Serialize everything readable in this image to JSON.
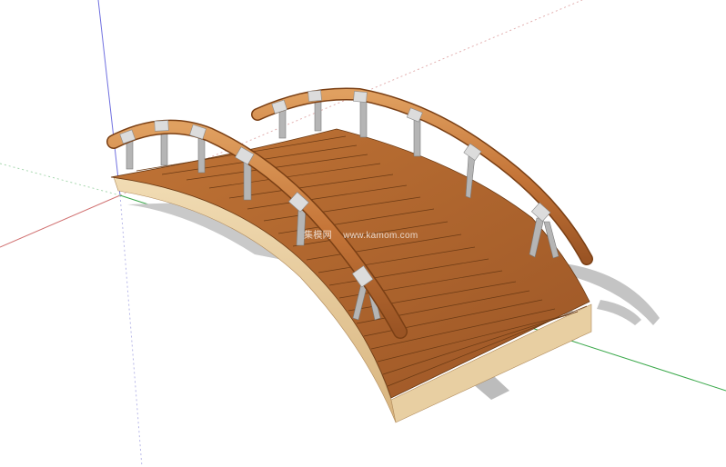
{
  "scene": {
    "subject": "arched wooden footbridge",
    "watermark": {
      "site_name": "集模网",
      "url": "www.kamom.com"
    }
  },
  "colors": {
    "background": "#ffffff",
    "axis_red": "#d07070",
    "axis_green": "#3aa84a",
    "axis_blue": "#7070e0",
    "deck_wood": "#b0662e",
    "deck_wood_dark": "#8a4b1e",
    "deck_side": "#e6c79a",
    "rail_wood": "#c77a3e",
    "metal": "#c8c8c8",
    "shadow": "#bdbdbd"
  }
}
